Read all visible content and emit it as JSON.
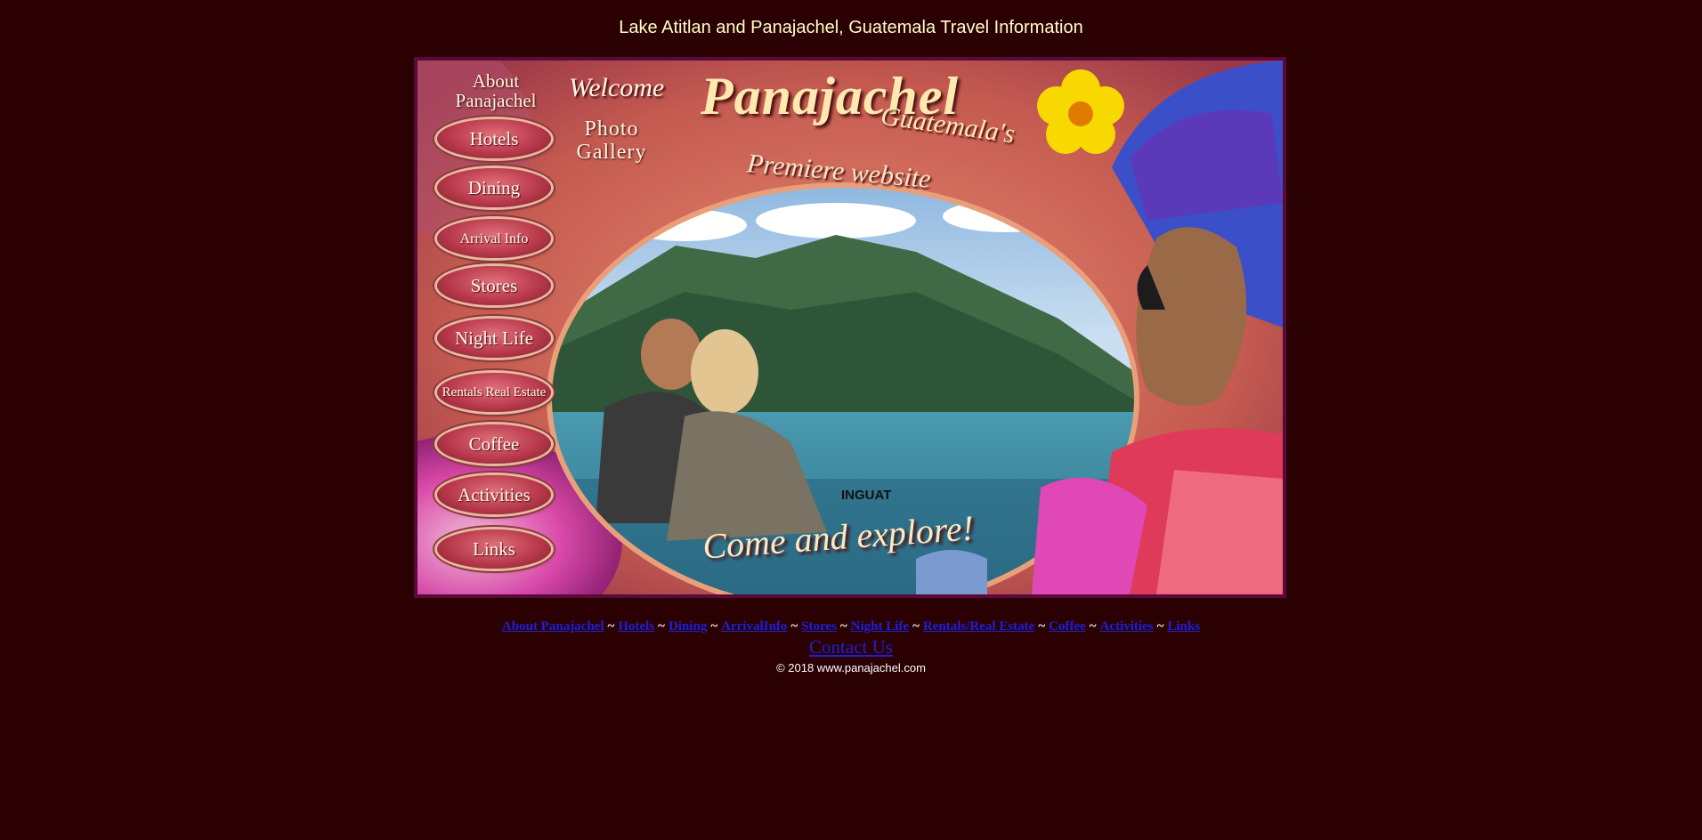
{
  "page": {
    "title": "Lake Atitlan and Panajachel, Guatemala Travel Information"
  },
  "banner": {
    "welcome": "Welcome",
    "brand": "Panajachel",
    "brand_sub": "Guatemala's",
    "tagline": "Premiere website",
    "cta": "Come and explore!",
    "logo_text": "INGUAT",
    "photo_gallery": "Photo Gallery",
    "about": "About Panajachel",
    "nav": [
      {
        "label": "Hotels"
      },
      {
        "label": "Dining"
      },
      {
        "label": "Arrival Info"
      },
      {
        "label": "Stores"
      },
      {
        "label": "Night Life"
      },
      {
        "label": "Rentals Real Estate"
      },
      {
        "label": "Coffee"
      },
      {
        "label": "Activities"
      },
      {
        "label": "Links"
      }
    ]
  },
  "footer": {
    "links": [
      {
        "label": "About Panajachel"
      },
      {
        "label": "Hotels"
      },
      {
        "label": "Dining"
      },
      {
        "label": "ArrivalInfo"
      },
      {
        "label": "Stores"
      },
      {
        "label": "Night Life"
      },
      {
        "label": "Rentals/Real Estate"
      },
      {
        "label": "Coffee"
      },
      {
        "label": "Activities"
      },
      {
        "label": "Links"
      }
    ],
    "separator": "~",
    "contact": "Contact Us",
    "copyright": "© 2018 www.panajachel.com"
  }
}
